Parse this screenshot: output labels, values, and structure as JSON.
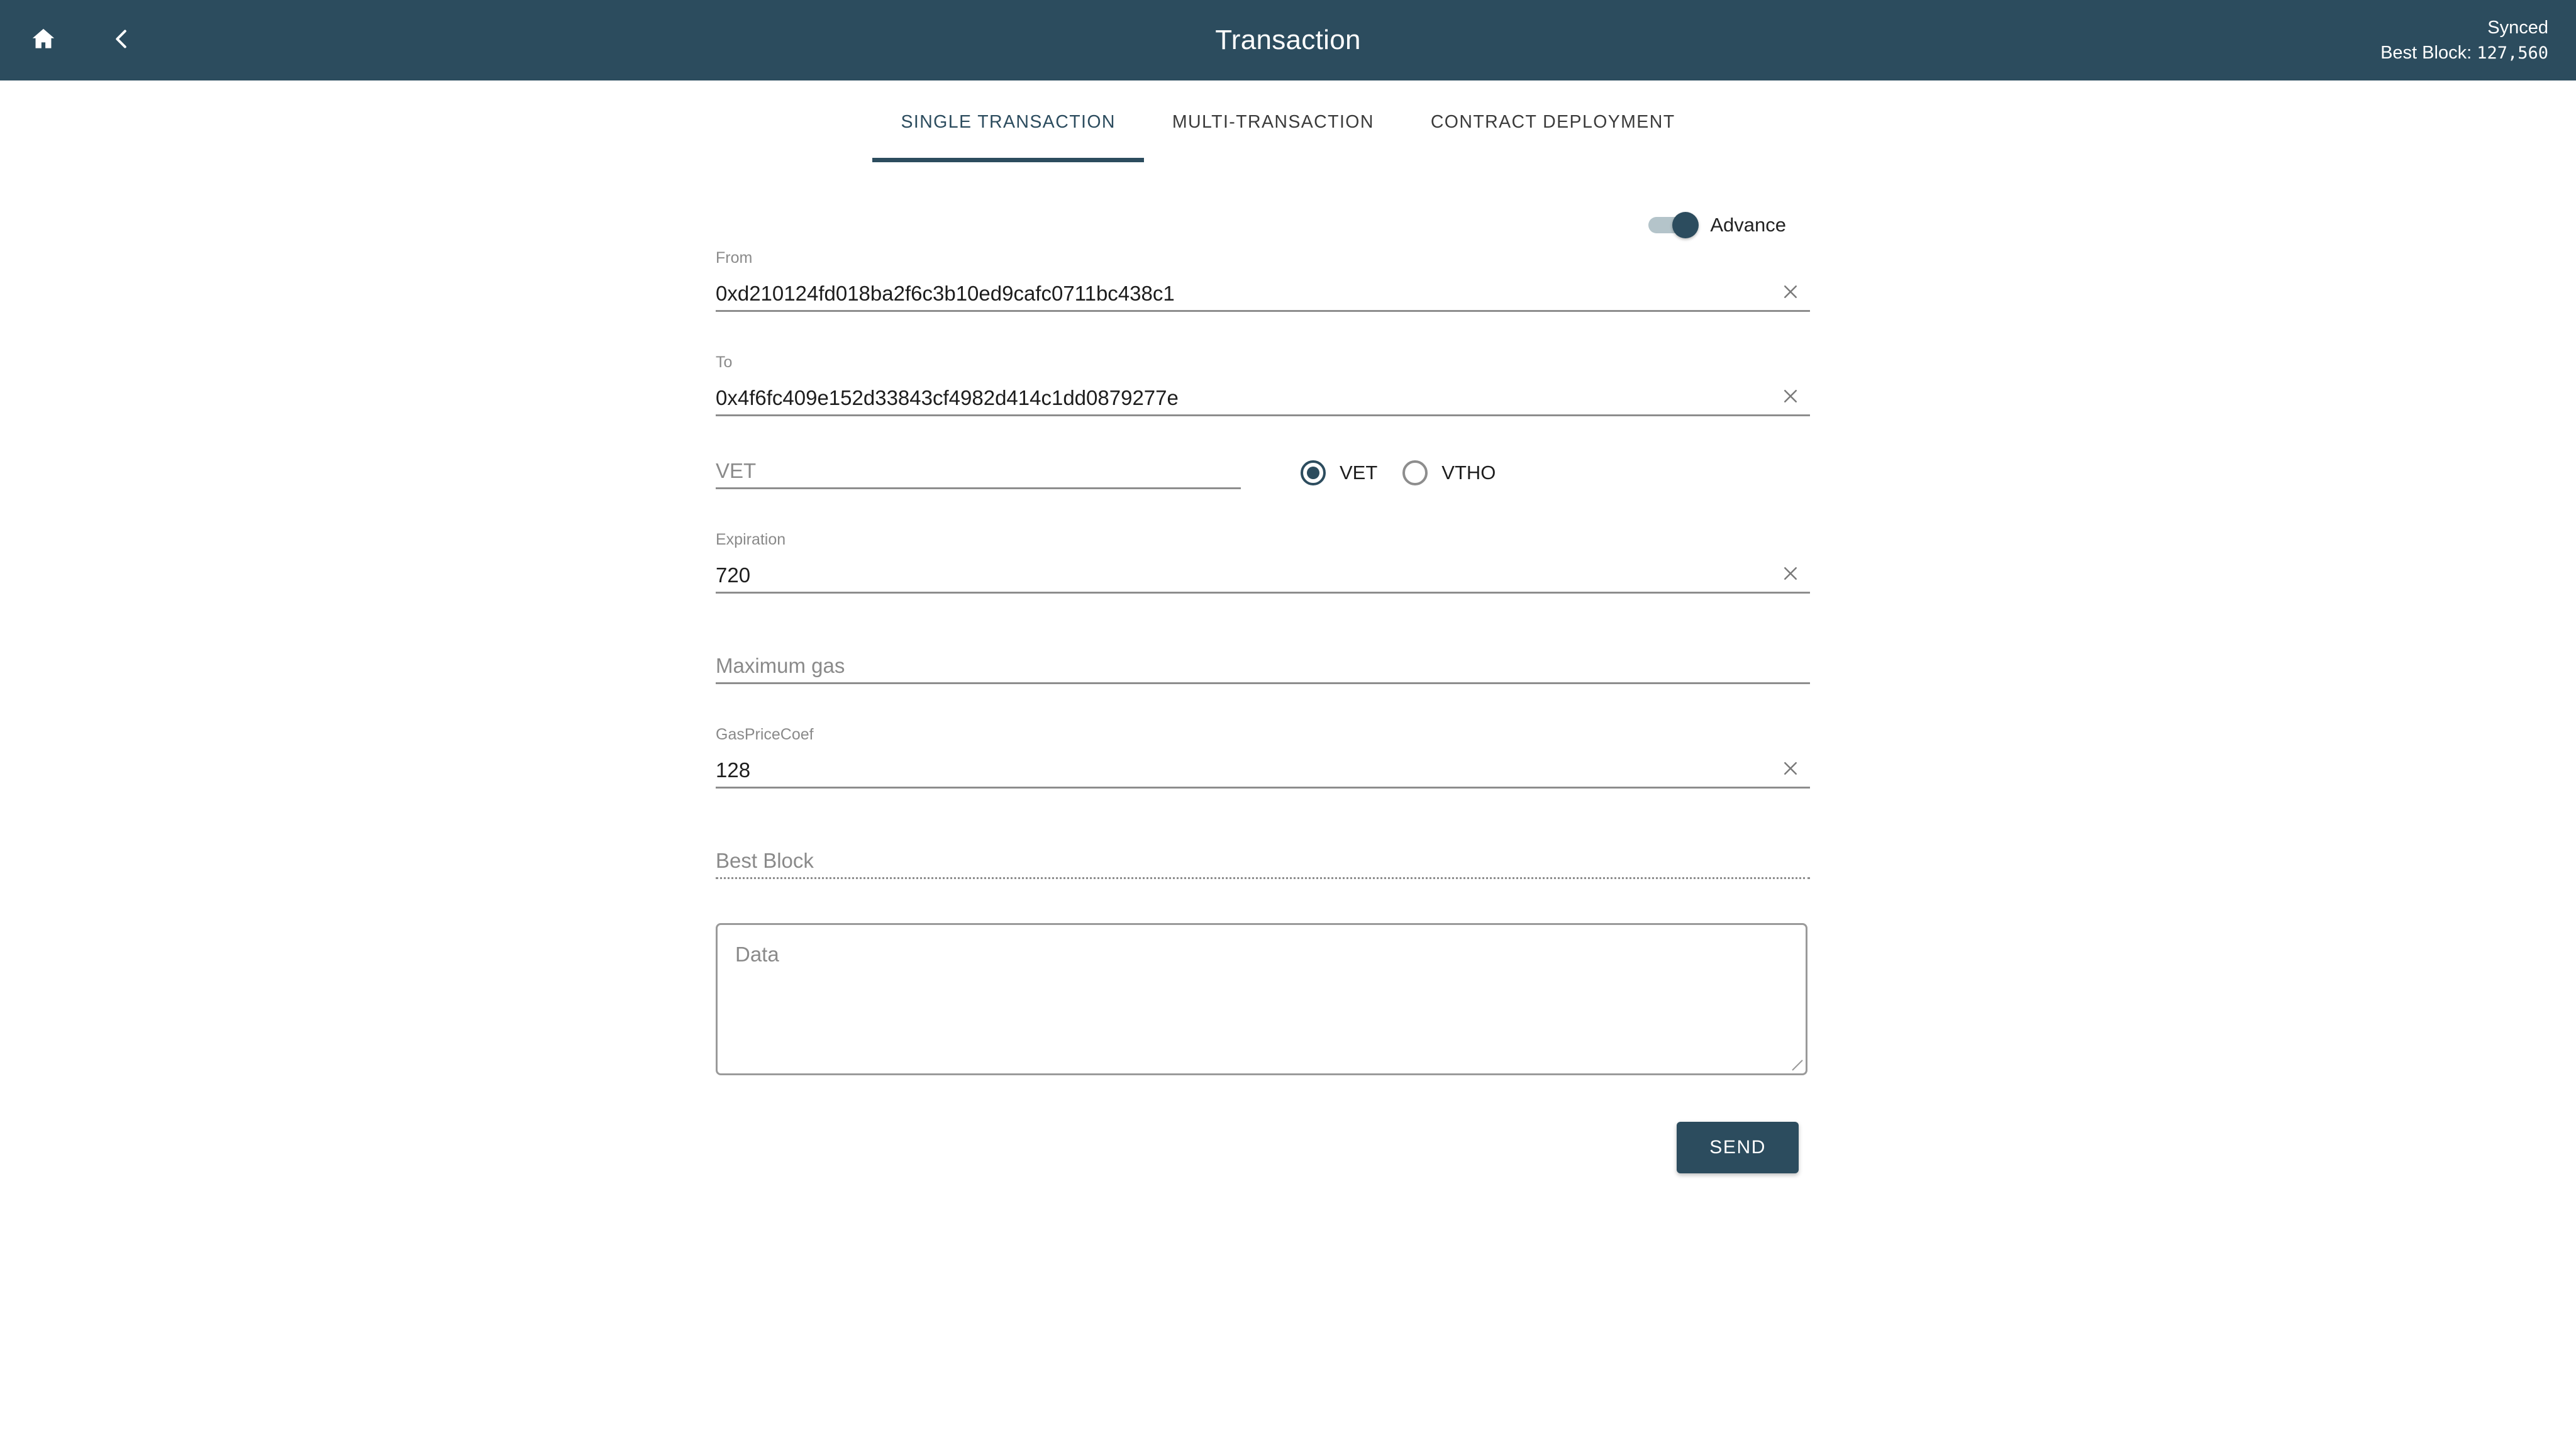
{
  "header": {
    "title": "Transaction",
    "home_icon": "home-icon",
    "back_icon": "chevron-left-icon",
    "sync_status": "Synced",
    "best_block_label": "Best Block:",
    "best_block_value": "127,560",
    "background_color": "#2C4C5E"
  },
  "tabs": [
    {
      "label": "SINGLE TRANSACTION",
      "active": true
    },
    {
      "label": "MULTI-TRANSACTION",
      "active": false
    },
    {
      "label": "CONTRACT DEPLOYMENT",
      "active": false
    }
  ],
  "advance": {
    "label": "Advance",
    "enabled": true
  },
  "fields": {
    "from": {
      "label": "From",
      "value": "0xd210124fd018ba2f6c3b10ed9cafc0711bc438c1",
      "clear_icon": "close-icon"
    },
    "to": {
      "label": "To",
      "value": "0x4f6fc409e152d33843cf4982d414c1dd0879277e",
      "clear_icon": "close-icon"
    },
    "amount": {
      "placeholder": "VET",
      "value": ""
    },
    "expiration": {
      "label": "Expiration",
      "value": "720",
      "clear_icon": "close-icon"
    },
    "maximum_gas": {
      "placeholder": "Maximum gas",
      "value": ""
    },
    "gas_price_coef": {
      "label": "GasPriceCoef",
      "value": "128",
      "clear_icon": "close-icon"
    },
    "best_block": {
      "placeholder": "Best Block",
      "value": "",
      "disabled": true
    },
    "data": {
      "placeholder": "Data",
      "value": ""
    }
  },
  "token_options": [
    {
      "label": "VET",
      "selected": true
    },
    {
      "label": "VTHO",
      "selected": false
    }
  ],
  "actions": {
    "send_label": "SEND"
  },
  "colors": {
    "accent": "#2C4C5E",
    "muted_text": "#8a8a8a",
    "line": "#8d8d8d"
  }
}
